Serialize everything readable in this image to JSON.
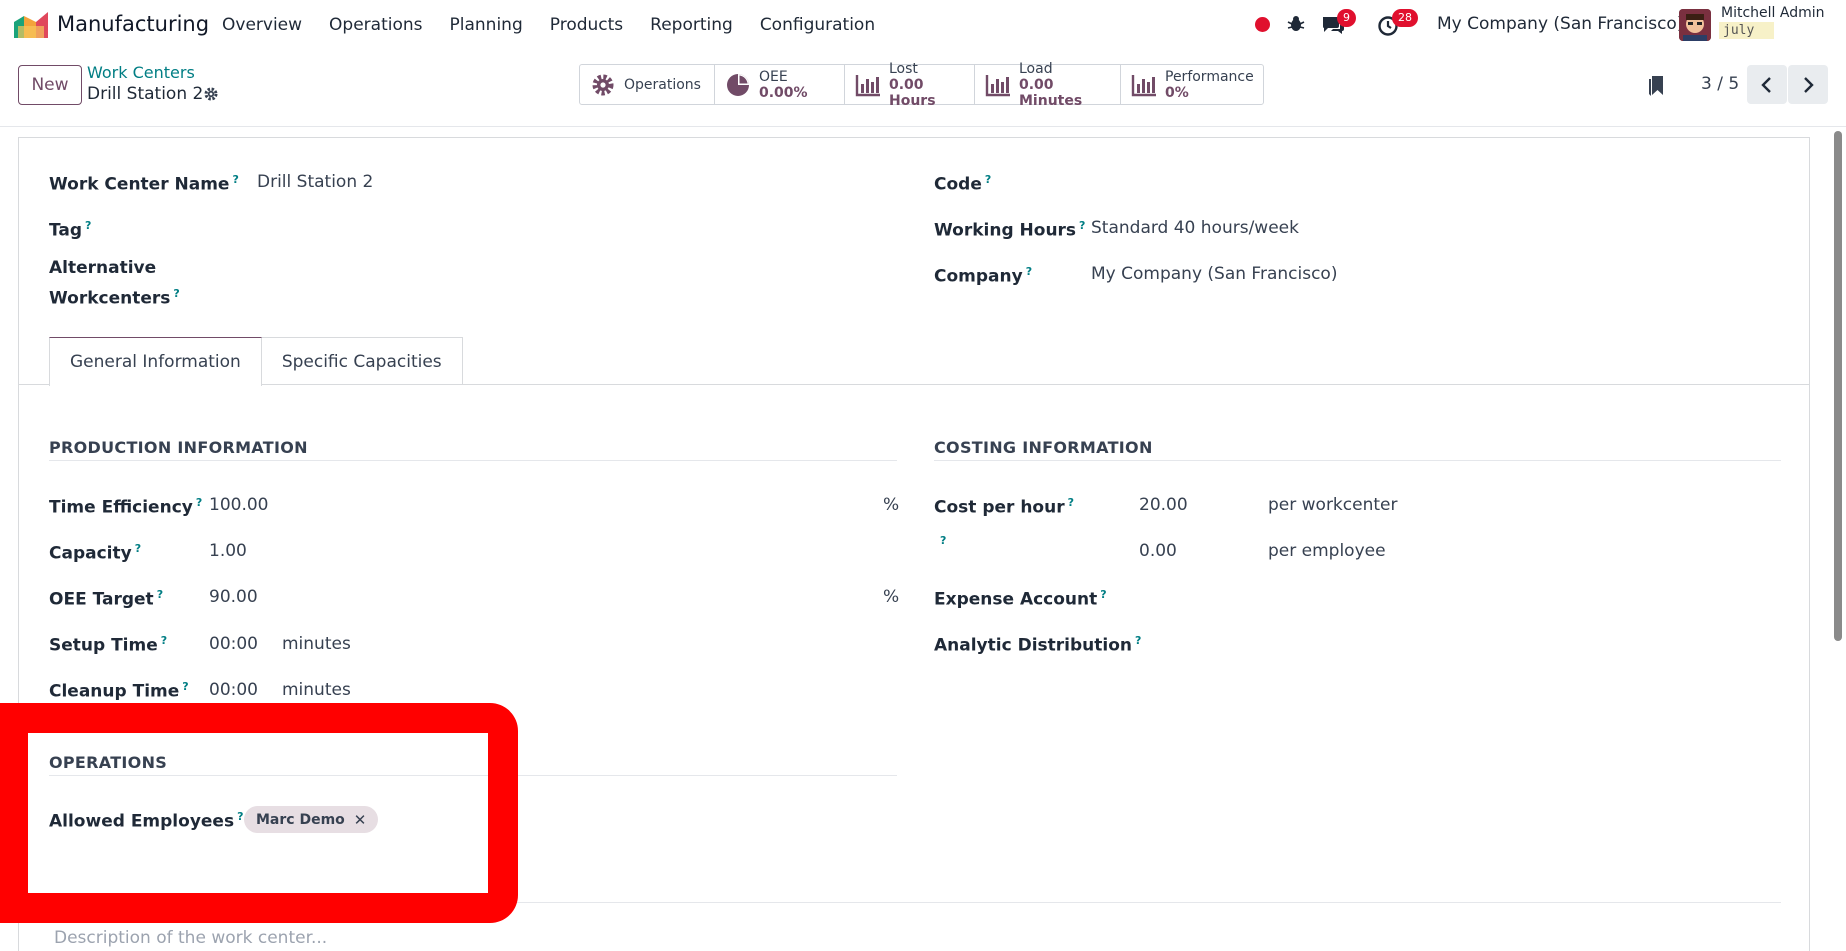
{
  "navbar": {
    "app_name": "Manufacturing",
    "menu": [
      "Overview",
      "Operations",
      "Planning",
      "Products",
      "Reporting",
      "Configuration"
    ],
    "messages_count": "9",
    "activities_count": "28",
    "company": "My Company (San Francisco)",
    "user_name": "Mitchell Admin",
    "db_name": "july"
  },
  "control": {
    "new_label": "New",
    "breadcrumb_parent": "Work Centers",
    "breadcrumb_current": "Drill Station 2",
    "stats": {
      "operations": "Operations",
      "oee_label": "OEE",
      "oee_value": "0.00%",
      "lost_label": "Lost",
      "lost_value": "0.00 Hours",
      "load_label": "Load",
      "load_value": "0.00 Minutes",
      "perf_label": "Performance",
      "perf_value": "0%"
    },
    "pager": "3 / 5"
  },
  "form": {
    "work_center_name_label": "Work Center Name",
    "work_center_name": "Drill Station 2",
    "tag_label": "Tag",
    "alt_label_1": "Alternative",
    "alt_label_2": "Workcenters",
    "code_label": "Code",
    "working_hours_label": "Working Hours",
    "working_hours": "Standard 40 hours/week",
    "company_label": "Company",
    "company": "My Company (San Francisco)",
    "tabs": [
      "General Information",
      "Specific Capacities"
    ],
    "production": {
      "title": "PRODUCTION INFORMATION",
      "time_eff_label": "Time Efficiency",
      "time_eff": "100.00",
      "pct": "%",
      "capacity_label": "Capacity",
      "capacity": "1.00",
      "oee_target_label": "OEE Target",
      "oee_target": "90.00",
      "setup_label": "Setup Time",
      "setup": "00:00",
      "cleanup_label": "Cleanup Time",
      "cleanup": "00:00",
      "minutes": "minutes"
    },
    "costing": {
      "title": "COSTING INFORMATION",
      "cost_hour_label": "Cost per hour",
      "cost_hour": "20.00",
      "per_workcenter": "per workcenter",
      "employee_cost": "0.00",
      "per_employee": "per employee",
      "expense_label": "Expense Account",
      "analytic_label": "Analytic Distribution"
    },
    "operations": {
      "title": "OPERATIONS",
      "allowed_label": "Allowed Employees",
      "employee_tag": "Marc Demo"
    },
    "description_placeholder": "Description of the work center..."
  },
  "colors": {
    "accent": "#714b67",
    "link": "#017e84",
    "highlight": "#ff0000"
  }
}
